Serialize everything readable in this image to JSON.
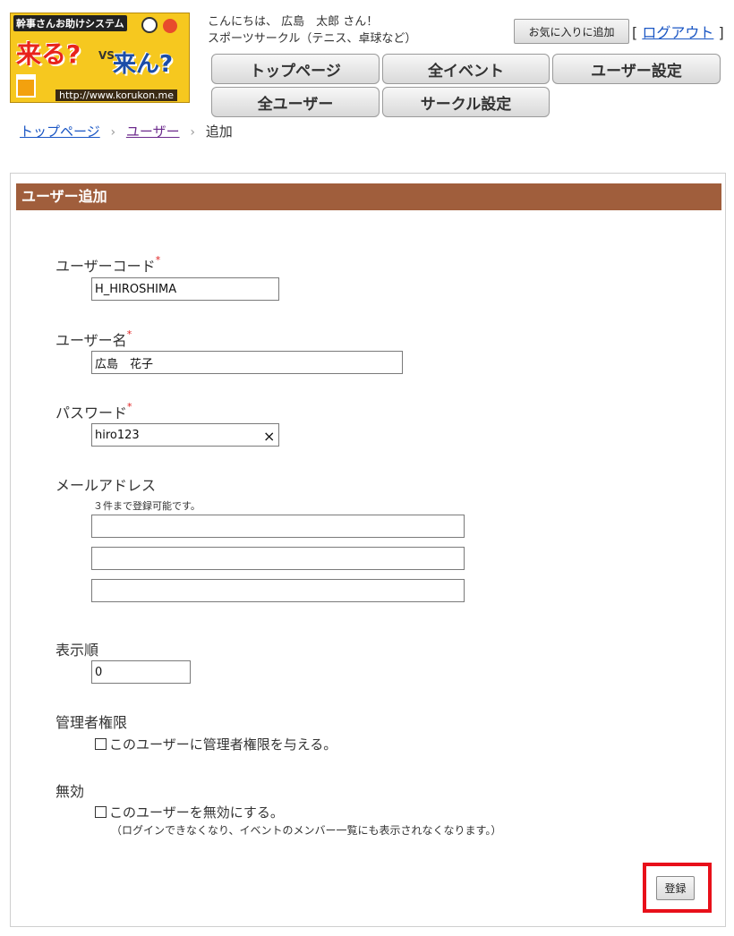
{
  "header": {
    "logo": {
      "tagline": "幹事さんお助けシステム",
      "word1": "来る?",
      "vs": "VS",
      "word2": "来ん?",
      "url": "http://www.korukon.me"
    },
    "greeting_line1": "こんにちは、 広島　太郎 さん！",
    "greeting_line2": "スポーツサークル（テニス、卓球など）",
    "favorite_button": "お気に入りに追加",
    "logout_open": "[",
    "logout_label": "ログアウト",
    "logout_close": "]"
  },
  "nav": {
    "top": "トップページ",
    "all_events": "全イベント",
    "user_settings": "ユーザー設定",
    "all_users": "全ユーザー",
    "circle_settings": "サークル設定"
  },
  "breadcrumb": {
    "home": "トップページ",
    "users": "ユーザー",
    "current": "追加",
    "separator": "›"
  },
  "form": {
    "title": "ユーザー追加",
    "required_mark": "*",
    "user_code": {
      "label": "ユーザーコード",
      "value": "H_HIROSHIMA"
    },
    "user_name": {
      "label": "ユーザー名",
      "value": "広島　花子"
    },
    "password": {
      "label": "パスワード",
      "value": "hiro123",
      "clear_icon": "×"
    },
    "email": {
      "label": "メールアドレス",
      "hint": "３件まで登録可能です。",
      "values": [
        "",
        "",
        ""
      ]
    },
    "display_order": {
      "label": "表示順",
      "value": "0"
    },
    "admin": {
      "label": "管理者権限",
      "checkbox_label": "このユーザーに管理者権限を与える。",
      "checked": false
    },
    "disabled": {
      "label": "無効",
      "checkbox_label": "このユーザーを無効にする。",
      "note": "（ログインできなくなり、イベントのメンバー一覧にも表示されなくなります。）",
      "checked": false
    },
    "submit_label": "登録"
  },
  "colors": {
    "panel_title_bg": "#a05e3c",
    "link": "#1a56c4",
    "highlight": "#e8101a",
    "required": "#e02020"
  }
}
